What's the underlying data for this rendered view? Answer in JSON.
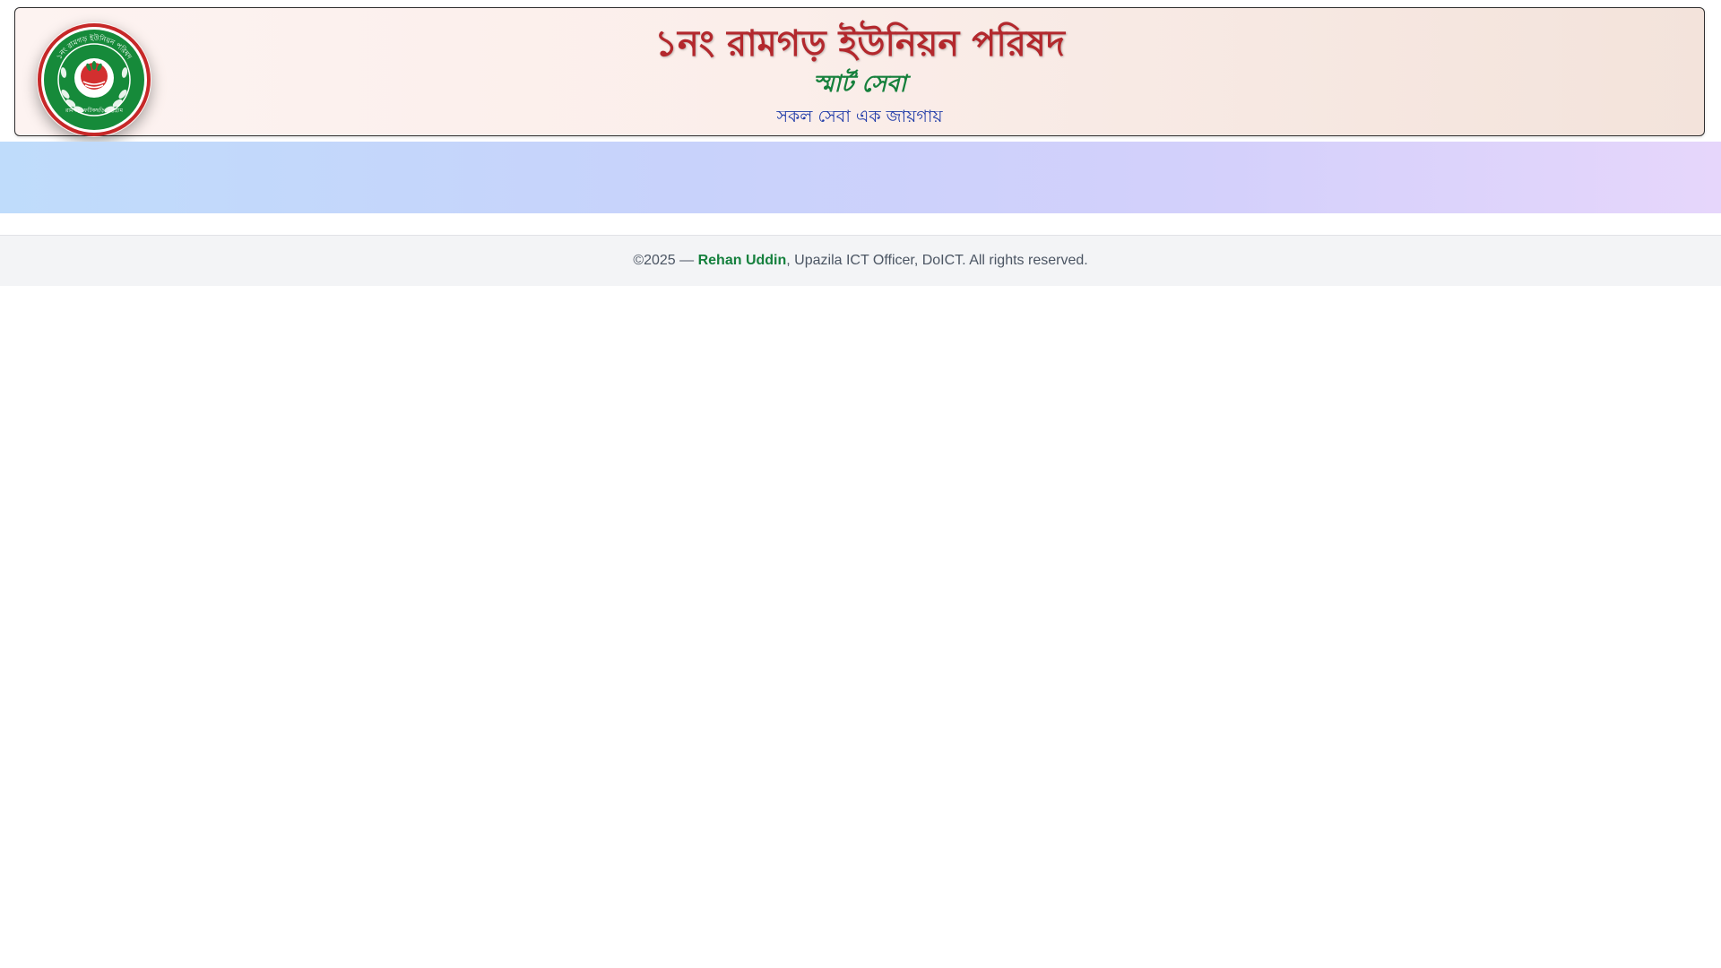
{
  "header": {
    "title": "১নং রামগড় ইউনিয়ন পরিষদ",
    "subtitle": "স্মার্ট সেবা",
    "tagline": "সকল সেবা এক জায়গায়",
    "logo": {
      "icon": "union-parishad-seal-icon",
      "seal_text_top": "১নং রামগড় ইউনিয়ন পরিষদ",
      "seal_text_bottom": "রামগড়, ফটিকছড়ি, চট্টগ্রাম"
    }
  },
  "banner": {
    "colors": [
      "#bfdcfb",
      "#c8d2fb",
      "#d3d0fb",
      "#e6d6fb"
    ]
  },
  "footer": {
    "prefix": "©2025 — ",
    "author": "Rehan Uddin",
    "suffix": ", Upazila ICT Officer, DoICT. All rights reserved."
  },
  "colors": {
    "title": "#b3282d",
    "subtitle": "#16803c",
    "tagline": "#1e3aa8",
    "author": "#15803d"
  }
}
